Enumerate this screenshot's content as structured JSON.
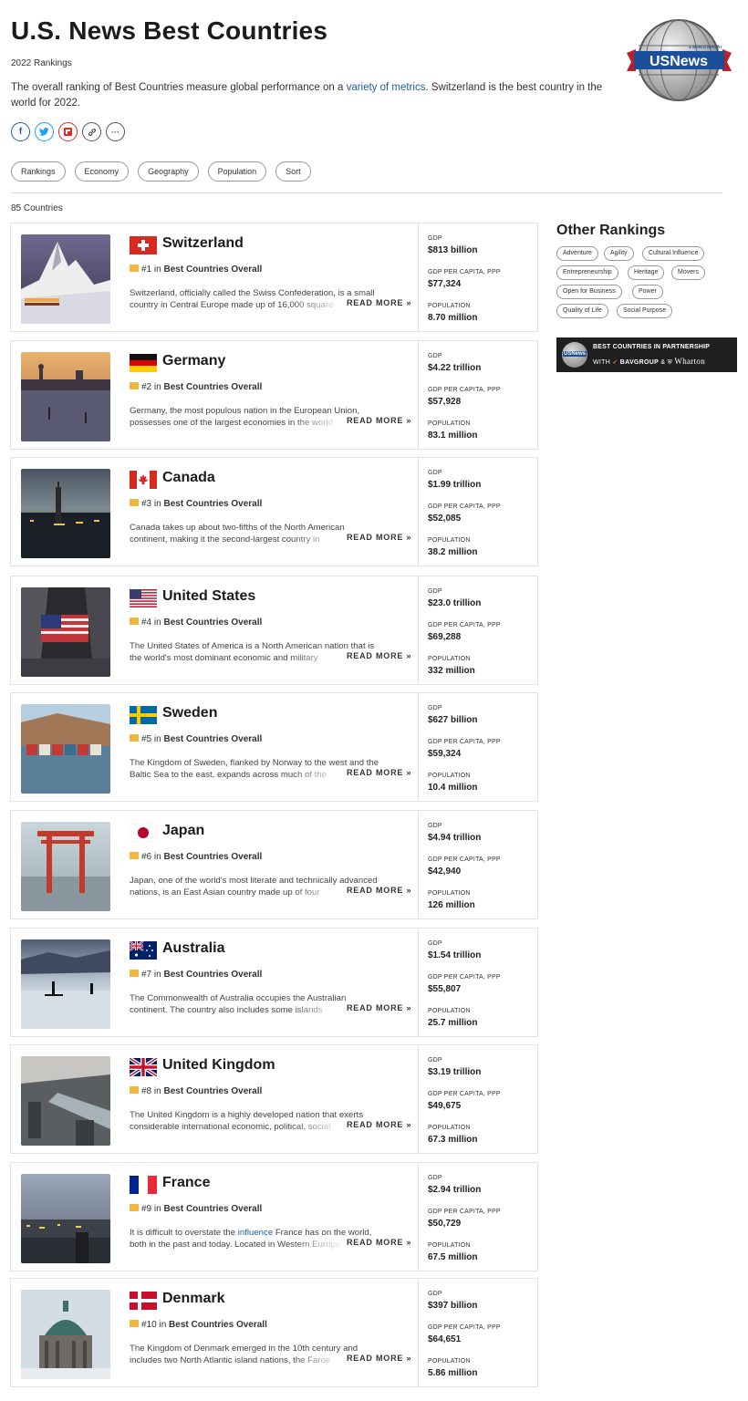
{
  "header": {
    "title": "U.S. News Best Countries",
    "subtitle": "2022 Rankings",
    "intro_before": "The overall ranking of Best Countries measure global performance on a ",
    "intro_link": "variety of metrics",
    "intro_after": ". Switzerland is the best country in the world for 2022.",
    "logo_text": "USNews",
    "logo_small_text": "A WORLD REPORT"
  },
  "share": [
    "f",
    "t",
    "f",
    "link",
    "···"
  ],
  "filters": [
    "Rankings",
    "Economy",
    "Geography",
    "Population",
    "Sort"
  ],
  "count_text": "85 Countries",
  "rank_suffix": "in",
  "rank_category": "Best Countries Overall",
  "read_more": "READ MORE »",
  "stat_labels": {
    "gdp": "GDP",
    "gdp_pc": "GDP PER CAPITA, PPP",
    "pop": "POPULATION"
  },
  "countries": [
    {
      "name": "Switzerland",
      "rank": "#1",
      "desc1": "Switzerland, officially called the Swiss Confederation, is a small",
      "desc2": "country in Central Europe made up of 16,000 square",
      "gdp": "$813 billion",
      "gdp_pc": "$77,324",
      "pop": "8.70 million"
    },
    {
      "name": "Germany",
      "rank": "#2",
      "desc1": "Germany, the most populous nation in the European Union,",
      "desc2": "possesses one of the largest economies in the world",
      "gdp": "$4.22 trillion",
      "gdp_pc": "$57,928",
      "pop": "83.1 million"
    },
    {
      "name": "Canada",
      "rank": "#3",
      "desc1": "Canada takes up about two-fifths of the North American",
      "desc2": "continent, making it the second-largest country in",
      "gdp": "$1.99 trillion",
      "gdp_pc": "$52,085",
      "pop": "38.2 million"
    },
    {
      "name": "United States",
      "rank": "#4",
      "desc1": "The United States of America is a North American nation that is",
      "desc2": "the world's most dominant economic and military",
      "gdp": "$23.0 trillion",
      "gdp_pc": "$69,288",
      "pop": "332 million"
    },
    {
      "name": "Sweden",
      "rank": "#5",
      "desc1": "The Kingdom of Sweden, flanked by Norway to the west and the",
      "desc2": "Baltic Sea to the east, expands across much of the",
      "gdp": "$627 billion",
      "gdp_pc": "$59,324",
      "pop": "10.4 million"
    },
    {
      "name": "Japan",
      "rank": "#6",
      "desc1": "Japan, one of the world's most literate and technically advanced",
      "desc2": "nations, is an East Asian country made up of four",
      "gdp": "$4.94 trillion",
      "gdp_pc": "$42,940",
      "pop": "126 million"
    },
    {
      "name": "Australia",
      "rank": "#7",
      "desc1": "The Commonwealth of Australia occupies the Australian",
      "desc2": "continent. The country also includes some islands",
      "gdp": "$1.54 trillion",
      "gdp_pc": "$55,807",
      "pop": "25.7 million"
    },
    {
      "name": "United Kingdom",
      "rank": "#8",
      "desc1": "The United Kingdom is a highly developed nation that exerts",
      "desc2": "considerable international economic, political, social",
      "gdp": "$3.19 trillion",
      "gdp_pc": "$49,675",
      "pop": "67.3 million"
    },
    {
      "name": "France",
      "rank": "#9",
      "desc1_before": "It is difficult to overstate the ",
      "desc1_link": "influence",
      "desc1_after": " France has on the world,",
      "desc2": "both in the past and today. Located in Western Europe",
      "gdp": "$2.94 trillion",
      "gdp_pc": "$50,729",
      "pop": "67.5 million"
    },
    {
      "name": "Denmark",
      "rank": "#10",
      "desc1": "The Kingdom of Denmark emerged in the 10th century and",
      "desc2": "includes two North Atlantic island nations, the Faroe",
      "gdp": "$397 billion",
      "gdp_pc": "$64,651",
      "pop": "5.86 million"
    }
  ],
  "sidebar": {
    "title": "Other Rankings",
    "tags": [
      "Adventure",
      "Agility",
      "Cultural Influence",
      "Entrepreneurship",
      "Heritage",
      "Movers",
      "Open for Business",
      "Power",
      "Quality of Life",
      "Social Purpose"
    ],
    "partner_line1": "BEST COUNTRIES IN PARTNERSHIP",
    "partner_with": "WITH",
    "partner_bav": "BAVGROUP",
    "partner_amp": "&",
    "partner_wharton": "Wharton",
    "partner_logo": "USNews"
  }
}
